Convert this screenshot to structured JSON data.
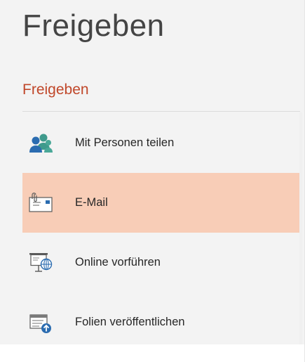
{
  "header": {
    "title": "Freigeben"
  },
  "section": {
    "title": "Freigeben"
  },
  "items": [
    {
      "label": "Mit Personen teilen",
      "icon": "people-icon",
      "selected": false
    },
    {
      "label": "E-Mail",
      "icon": "email-icon",
      "selected": true
    },
    {
      "label": "Online vorführen",
      "icon": "present-online-icon",
      "selected": false
    },
    {
      "label": "Folien veröffentlichen",
      "icon": "publish-slides-icon",
      "selected": false
    }
  ],
  "colors": {
    "accent": "#c0472a",
    "selected_bg": "#f8cdb7",
    "panel_bg": "#f3f3f3",
    "text": "#262626"
  }
}
